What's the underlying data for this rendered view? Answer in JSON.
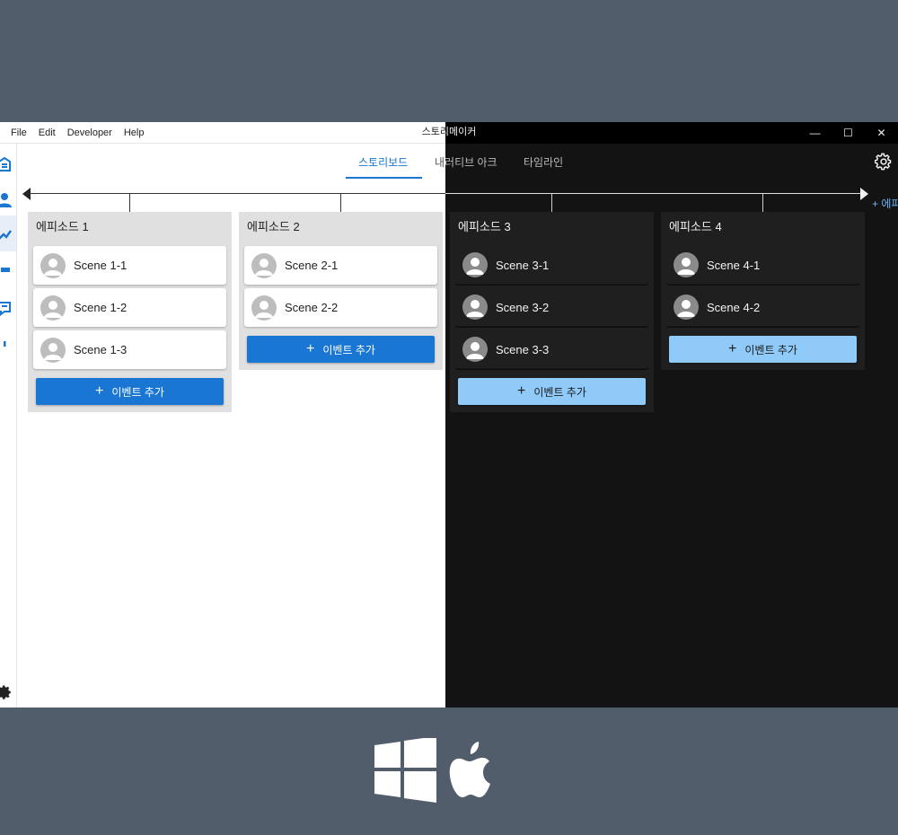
{
  "app": {
    "title": "스토리메이커"
  },
  "menu": {
    "items": [
      "File",
      "Edit",
      "Developer",
      "Help"
    ]
  },
  "window_controls": {
    "minimize": "—",
    "maximize": "☐",
    "close": "✕"
  },
  "tabs": [
    {
      "label": "스토리보드",
      "active": true
    },
    {
      "label": "내러티브 아크",
      "active": false
    },
    {
      "label": "타임라인",
      "active": false
    }
  ],
  "sidebar": {
    "icons": [
      "library-icon",
      "person-icon",
      "edit-icon",
      "flag-icon",
      "chat-icon",
      "more-icon",
      "settings-icon"
    ],
    "active_index": 2
  },
  "timeline": {
    "add_episode_label": "+ 에피소드 추가"
  },
  "episodes": [
    {
      "title": "에피소드 1",
      "scenes": [
        "Scene 1-1",
        "Scene 1-2",
        "Scene 1-3"
      ],
      "add_label": "이벤트 추가"
    },
    {
      "title": "에피소드 2",
      "scenes": [
        "Scene 2-1",
        "Scene 2-2"
      ],
      "add_label": "이벤트 추가"
    },
    {
      "title": "에피소드 3",
      "scenes": [
        "Scene 3-1",
        "Scene 3-2",
        "Scene 3-3"
      ],
      "add_label": "이벤트 추가"
    },
    {
      "title": "에피소드 4",
      "scenes": [
        "Scene 4-1",
        "Scene 4-2"
      ],
      "add_label": "이벤트 추가"
    }
  ],
  "os_logos": [
    "windows-logo",
    "apple-logo"
  ],
  "colors": {
    "accent": "#1976d2",
    "accent_dark_mode": "#90caf9",
    "background": "#525d6c",
    "dark_surface": "#131313",
    "light_column": "#e0e0e0",
    "dark_column": "#1f1f1f"
  }
}
